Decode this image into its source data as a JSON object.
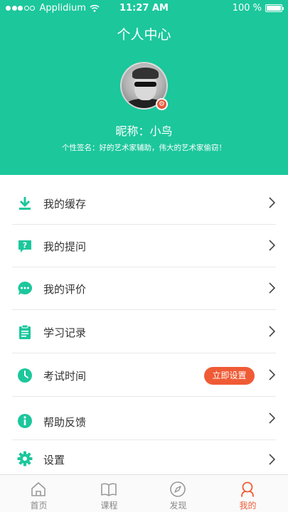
{
  "status_bar": {
    "carrier": "Applidium",
    "time": "11:27 AM",
    "battery": "100 %"
  },
  "header": {
    "title": "个人中心",
    "nickname": "昵称：小鸟",
    "signature": "个性签名：好的艺术家辅助，伟大的艺术家偷窃！"
  },
  "menu": {
    "items": [
      {
        "label": "我的缓存",
        "icon": "download-icon"
      },
      {
        "label": "我的提问",
        "icon": "question-icon"
      },
      {
        "label": "我的评价",
        "icon": "comment-icon"
      },
      {
        "label": "学习记录",
        "icon": "clipboard-icon"
      },
      {
        "label": "考试时间",
        "icon": "clock-icon",
        "action_label": "立即设置"
      },
      {
        "label": "帮助反馈",
        "icon": "info-icon"
      },
      {
        "label": "设置",
        "icon": "gear-icon"
      }
    ]
  },
  "tabbar": {
    "tabs": [
      {
        "label": "首页",
        "icon": "home-icon"
      },
      {
        "label": "课程",
        "icon": "book-icon"
      },
      {
        "label": "发现",
        "icon": "compass-icon"
      },
      {
        "label": "我的",
        "icon": "user-icon",
        "active": true
      }
    ]
  },
  "colors": {
    "brand": "#1cc79c",
    "accent": "#ef5b35"
  }
}
